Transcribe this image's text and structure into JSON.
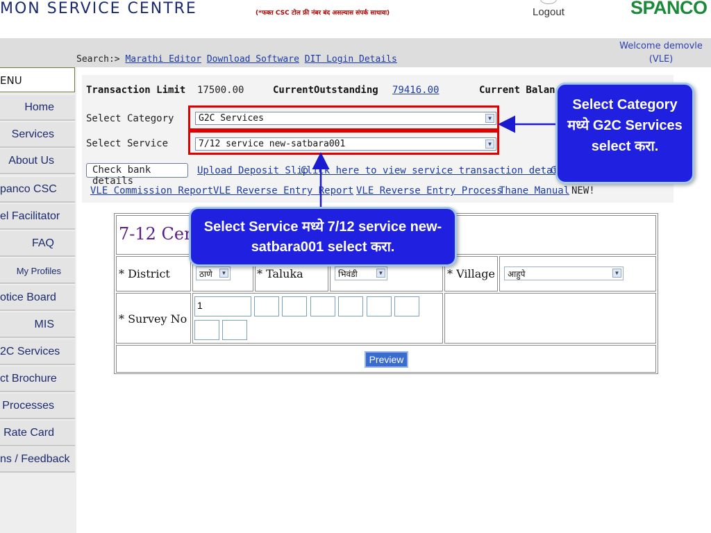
{
  "header": {
    "brand_left": "MON SERVICE CENTRE",
    "toll_free_note": "(*फक्त CSC टोल फ्री नंबर बंद असल्यास संपर्क साधावा)",
    "logout": "Logout",
    "brand_right": "SPANCO"
  },
  "search": {
    "prefix": "Search:>",
    "links": [
      "Marathi Editor",
      "Download Software",
      "DIT Login Details"
    ]
  },
  "welcome": {
    "line1": "Welcome demovle",
    "line2": "(VLE)"
  },
  "sidebar": {
    "head": "ENU",
    "items": [
      {
        "label": "Home"
      },
      {
        "label": "Services"
      },
      {
        "label": "About Us"
      },
      {
        "label": "panco CSC"
      },
      {
        "label": "el Facilitator"
      },
      {
        "label": "FAQ"
      },
      {
        "label": "My Profiles"
      },
      {
        "label": "otice Board"
      },
      {
        "label": "MIS"
      },
      {
        "label": "2C Services"
      },
      {
        "label": "ct Brochure"
      },
      {
        "label": "Processes"
      },
      {
        "label": "Rate Card"
      },
      {
        "label": "ns / Feedback"
      }
    ]
  },
  "panel": {
    "transaction_limit_label": "Transaction Limit",
    "transaction_limit_value": "17500.00",
    "current_outstanding_label": "CurrentOutstanding",
    "current_outstanding_value": "79416.00",
    "current_balance_label": "Current Balanc",
    "select_category_label": "Select Category",
    "select_category_value": "G2C Services",
    "select_service_label": "Select Service",
    "select_service_value": "7/12 service new-satbara001",
    "check_bank": "Check bank details",
    "upload_deposit": "Upload Deposit Slip",
    "click_here": "Click here to view service transaction details",
    "g_link": "G",
    "row2_links": [
      "VLE Commission Report",
      "VLE Reverse Entry Report",
      "VLE Reverse Entry Process",
      "Thane Manual"
    ],
    "new_tag": "NEW!"
  },
  "form": {
    "title": "7-12 Cert",
    "district_label": "* District",
    "district_value": "ठाणे",
    "taluka_label": "* Taluka",
    "taluka_value": "भिवंडी",
    "village_label": "* Village",
    "village_value": "आहुपे",
    "survey_label": "* Survey No",
    "survey_first": "1",
    "preview": "Preview"
  },
  "callouts": {
    "category": "Select Category मध्ये G2C Services select करा.",
    "service": "Select Service मध्ये 7/12 service new-satbara001 select करा."
  },
  "colors": {
    "callout_bg": "#2020e0",
    "highlight_border": "#e00000",
    "link": "#1a3aa8",
    "brand_green": "#1a8a3a"
  }
}
